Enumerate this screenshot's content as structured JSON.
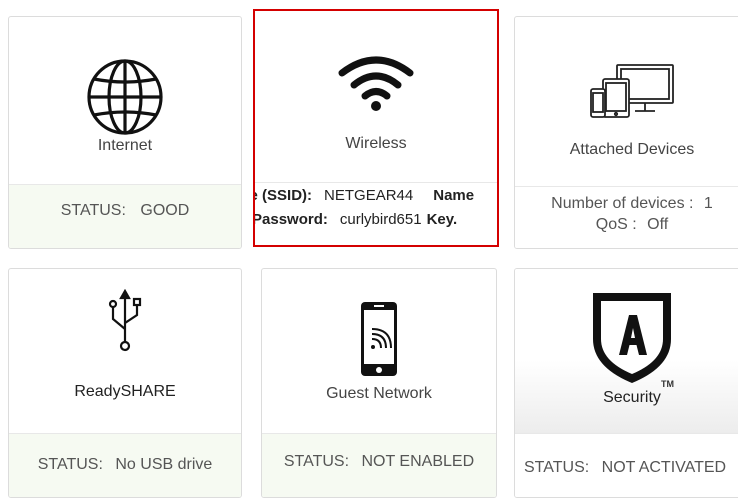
{
  "tiles": {
    "internet": {
      "title": "Internet",
      "status_label": "STATUS:",
      "status_value": "GOOD"
    },
    "wireless": {
      "title": "Wireless",
      "ssid_label": "Name (SSID):",
      "ssid_value": "NETGEAR44",
      "ssid_label_2": "Name",
      "password_label": "Password:",
      "password_value": "curlybird651",
      "password_label_2": "Key."
    },
    "attached_devices": {
      "title": "Attached Devices",
      "devices_label": "Number of devices :",
      "devices_value": "1",
      "qos_label": "QoS :",
      "qos_value": "Off"
    },
    "readyshare": {
      "title": "ReadySHARE",
      "status_label": "STATUS:",
      "status_value": "No USB drive"
    },
    "guest_network": {
      "title": "Guest Network",
      "status_label": "STATUS:",
      "status_value": "NOT ENABLED"
    },
    "security": {
      "title": "Security",
      "trademark": "TM",
      "status_label": "STATUS:",
      "status_value": "NOT ACTIVATED"
    }
  },
  "icons": {
    "internet": "globe-icon",
    "wireless": "wifi-icon",
    "attached_devices": "devices-icon",
    "readyshare": "usb-icon",
    "guest_network": "mobile-wifi-icon",
    "security": "security-shield-icon"
  },
  "colors": {
    "selected_border": "#d40000",
    "status_bg": "#f6faf2",
    "tile_border": "#dcdcdc"
  }
}
